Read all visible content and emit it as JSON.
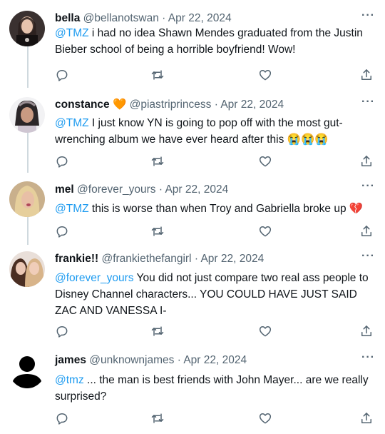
{
  "tweets": [
    {
      "name": "bella",
      "handle": "@bellanotswan",
      "sep": "·",
      "date": "Apr 22, 2024",
      "mention": "@TMZ",
      "lines": [
        "i had no idea Shawn Mendes graduated from the Justin",
        "Bieber school of being a horrible boyfriend! Wow!"
      ]
    },
    {
      "name": "constance",
      "name_emoji": "🧡",
      "handle": "@piastriprincess",
      "sep": "·",
      "date": "Apr 22, 2024",
      "mention": "@TMZ",
      "lines": [
        "I just know YN is going to pop off with the most gut-",
        "wrenching album we have ever heard after this"
      ],
      "trailing_emoji": "😭😭😭"
    },
    {
      "name": "mel",
      "handle": "@forever_yours",
      "sep": "·",
      "date": "Apr 22, 2024",
      "mention": "@TMZ",
      "lines": [
        "this is worse than when Troy and Gabriella broke up"
      ],
      "trailing_emoji": "💔"
    },
    {
      "name": "frankie!!",
      "handle": "@frankiethefangirl",
      "sep": "·",
      "date": "Apr 22, 2024",
      "mention": "@forever_yours",
      "lines": [
        "You did not just compare two real ass people to",
        "Disney Channel characters... YOU COULD HAVE JUST SAID",
        "ZAC AND VANESSA I-"
      ]
    },
    {
      "name": "james",
      "handle": "@unknownjames",
      "sep": "·",
      "date": "Apr 22, 2024",
      "mention": "@tmz",
      "lines": [
        "... the man is best friends with John Mayer... are we really",
        "surprised?"
      ]
    }
  ],
  "more_label": "···",
  "icons": [
    "reply-icon",
    "retweet-icon",
    "like-icon",
    "share-icon"
  ],
  "colors": {
    "mention": "#1d9bf0",
    "meta": "#536471",
    "line": "#cfd9de"
  }
}
